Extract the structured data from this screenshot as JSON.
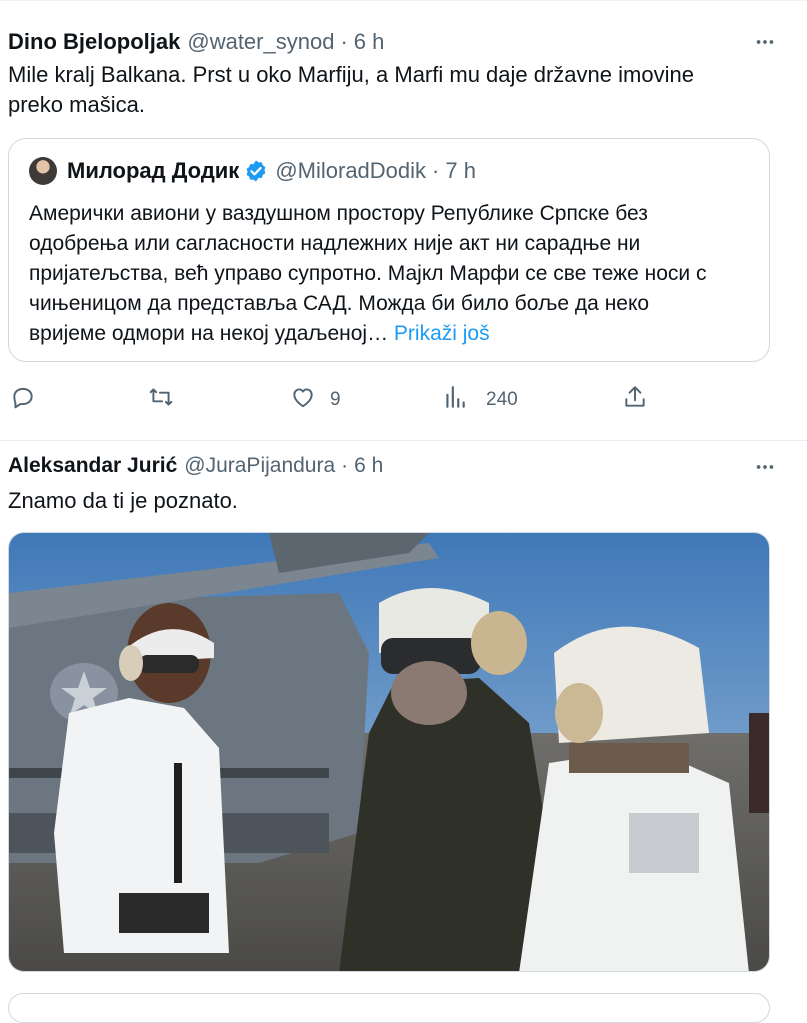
{
  "tweet1": {
    "name": "Dino Bjelopoljak",
    "handle": "@water_synod",
    "separator": "·",
    "time": "6 h",
    "text_lines": [
      "Mile kralj Balkana. Prst u oko Marfiju, a Marfi mu daje državne imovine",
      "preko mašica."
    ],
    "quote": {
      "name": "Милорад Додик",
      "handle": "@MiloradDodik",
      "separator": "·",
      "time": "7 h",
      "text_lines": [
        "Амерички авиони у ваздушном простору Републике Српске без",
        "одобрења или сагласности надлежних није акт ни сарадње ни",
        "пријатељства, већ управо супротно. Мајкл Марфи се све теже носи с",
        "чињеницом да представља САД. Можда би било боље да неко",
        "вријеме одмори на некој удаљеној…"
      ],
      "show_more": "Prikaži još"
    },
    "actions": {
      "reply": "",
      "retweet": "",
      "like": "9",
      "views": "240",
      "share": ""
    }
  },
  "tweet2": {
    "name": "Aleksandar Jurić",
    "handle": "@JuraPijandura",
    "separator": "·",
    "time": "6 h",
    "text": "Znamo da ti je poznato."
  },
  "icons": [
    "more-icon",
    "verified-badge-icon",
    "reply-icon",
    "retweet-icon",
    "like-icon",
    "views-icon",
    "share-icon"
  ],
  "colors": {
    "text": "#0f1419",
    "muted": "#536471",
    "link": "#1d9bf0",
    "border": "#cfd9de"
  }
}
